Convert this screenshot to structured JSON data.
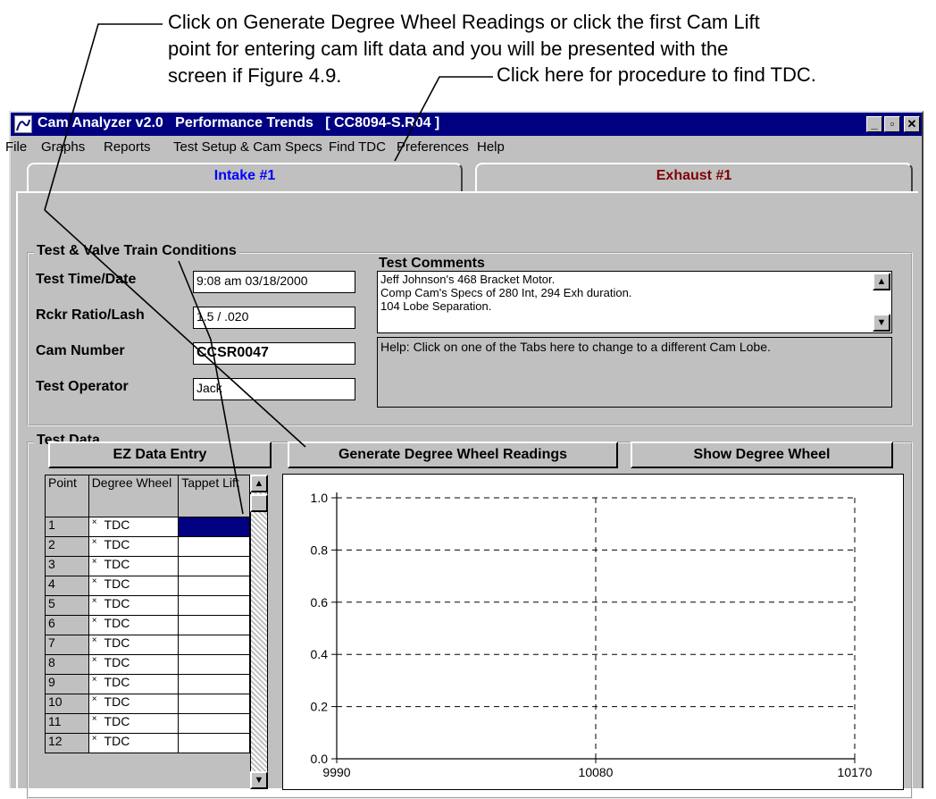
{
  "annotations": {
    "callout_1": [
      "Click on Generate Degree Wheel Readings or click the first Cam Lift",
      "point for entering cam lift data and you will be presented with the",
      "screen if Figure 4.9."
    ],
    "callout_2": "Click here for procedure to find TDC."
  },
  "window": {
    "title": "Cam Analyzer v2.0   Performance Trends   [ CC8094-S.R04 ]",
    "buttons": {
      "minimize": "_",
      "restore": "▫",
      "close": "✕"
    }
  },
  "menu": [
    "File",
    "Graphs",
    "Reports",
    "Test Setup & Cam Specs",
    "Find TDC",
    "Preferences",
    "Help"
  ],
  "tabs": [
    {
      "label": "Intake #1",
      "color": "#0000ff",
      "active": true
    },
    {
      "label": "Exhaust #1",
      "color": "#800000",
      "active": false
    }
  ],
  "conditions": {
    "group_label": "Test & Valve Train Conditions",
    "fields": [
      {
        "label": "Test Time/Date",
        "value": "9:08 am  03/18/2000"
      },
      {
        "label": "Rckr Ratio/Lash",
        "value": "1.5  /  .020"
      },
      {
        "label": "Cam Number",
        "value": "CCSR0047"
      },
      {
        "label": "Test Operator",
        "value": "Jack"
      }
    ]
  },
  "comments": {
    "label": "Test Comments",
    "lines": [
      "Jeff Johnson's 468 Bracket Motor.",
      "Comp Cam's Specs of 280 Int, 294 Exh duration.",
      "104 Lobe Separation."
    ],
    "help": "Help:  Click on one of the Tabs here to change to a different Cam Lobe."
  },
  "test_data": {
    "group_label": "Test Data",
    "buttons": [
      "EZ Data Entry",
      "Generate Degree Wheel Readings",
      "Show Degree Wheel"
    ],
    "columns": [
      "Point",
      "Degree Wheel",
      "Tappet Lift"
    ],
    "rows": [
      {
        "point": "1",
        "wheel": "TDC",
        "lift": ""
      },
      {
        "point": "2",
        "wheel": "TDC",
        "lift": ""
      },
      {
        "point": "3",
        "wheel": "TDC",
        "lift": ""
      },
      {
        "point": "4",
        "wheel": "TDC",
        "lift": ""
      },
      {
        "point": "5",
        "wheel": "TDC",
        "lift": ""
      },
      {
        "point": "6",
        "wheel": "TDC",
        "lift": ""
      },
      {
        "point": "7",
        "wheel": "TDC",
        "lift": ""
      },
      {
        "point": "8",
        "wheel": "TDC",
        "lift": ""
      },
      {
        "point": "9",
        "wheel": "TDC",
        "lift": ""
      },
      {
        "point": "10",
        "wheel": "TDC",
        "lift": ""
      },
      {
        "point": "11",
        "wheel": "TDC",
        "lift": ""
      },
      {
        "point": "12",
        "wheel": "TDC",
        "lift": ""
      }
    ],
    "row_marker": "×",
    "selected_cell_color": "#000080"
  },
  "chart_data": {
    "type": "line",
    "title": "",
    "xlabel": "",
    "ylabel": "",
    "xlim": [
      9990,
      10170
    ],
    "ylim": [
      0,
      1.0
    ],
    "x_ticks": [
      "9990",
      "10080",
      "10170"
    ],
    "y_ticks": [
      "0.0",
      "0.2",
      "0.4",
      "0.6",
      "0.8",
      "1.0"
    ],
    "grid": "dashed",
    "series": []
  }
}
